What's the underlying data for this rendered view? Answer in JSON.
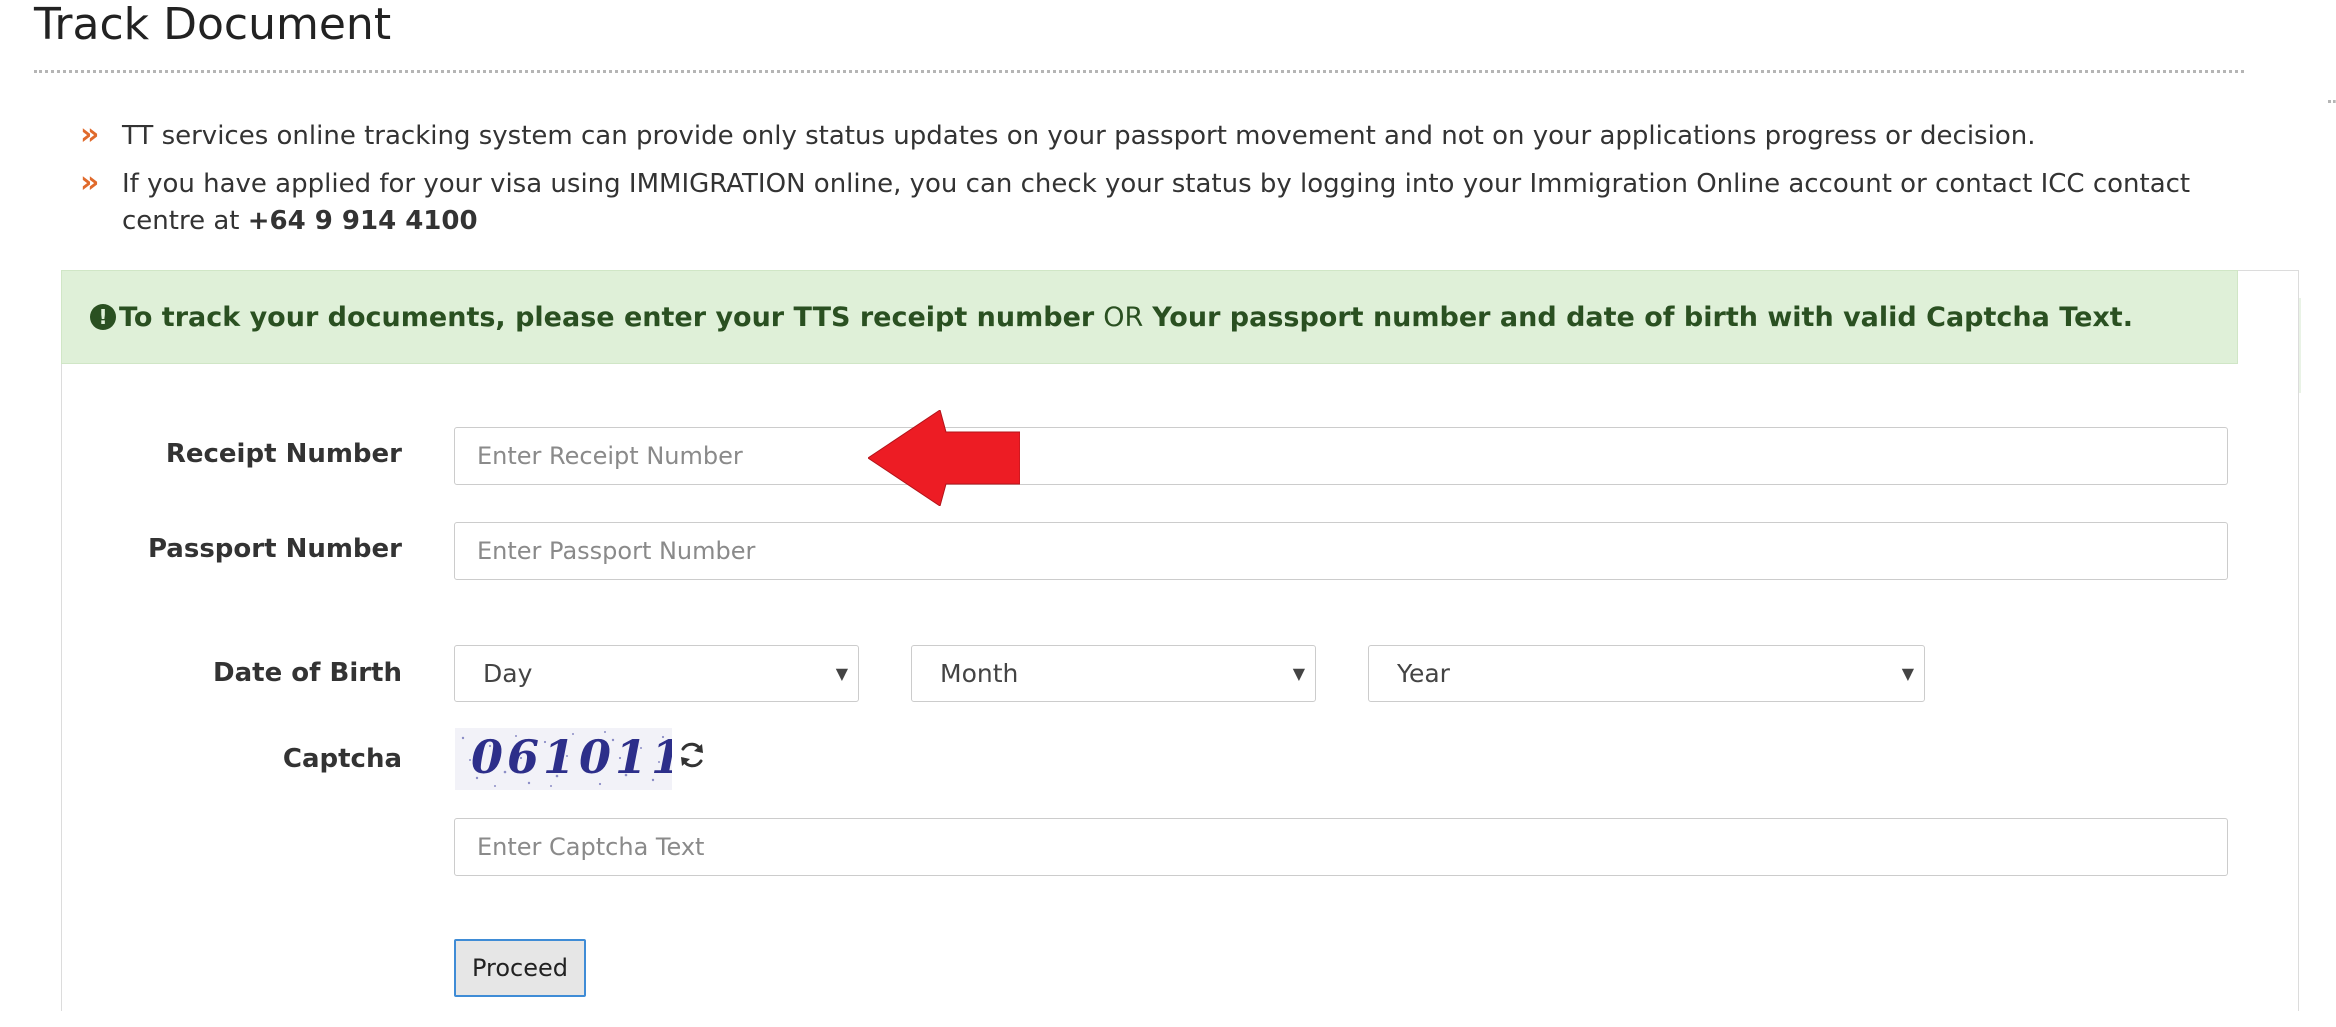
{
  "page": {
    "title": "Track Document"
  },
  "info": [
    {
      "text": "TT services online tracking system can provide only status updates on your passport movement and not on your applications progress or decision.",
      "phone": ""
    },
    {
      "text": "If you have applied for your visa using IMMIGRATION online, you can check your status by logging into your Immigration Online account or contact ICC contact centre at ",
      "phone": "+64 9 914 4100"
    }
  ],
  "notice": {
    "part1": "To track your documents, please enter your TTS receipt number",
    "or": "OR",
    "part2": "Your passport number and date of birth with valid Captcha Text."
  },
  "form": {
    "receipt_label": "Receipt Number",
    "receipt_placeholder": "Enter Receipt Number",
    "passport_label": "Passport Number",
    "passport_placeholder": "Enter Passport Number",
    "dob_label": "Date of Birth",
    "day": "Day",
    "month": "Month",
    "year": "Year",
    "captcha_label": "Captcha",
    "captcha_code": "061011",
    "captcha_placeholder": "Enter Captcha Text",
    "proceed_label": "Proceed"
  },
  "colors": {
    "bullet": "#e06a2c",
    "notice_bg": "#dff0d8",
    "notice_text": "#2a5021",
    "annotation_arrow": "#ed1c24"
  },
  "icons": {
    "bullet": "double-chevron-right-icon",
    "notice": "exclamation-circle-icon",
    "refresh": "refresh-icon",
    "annotation": "red-arrow-left-icon"
  }
}
